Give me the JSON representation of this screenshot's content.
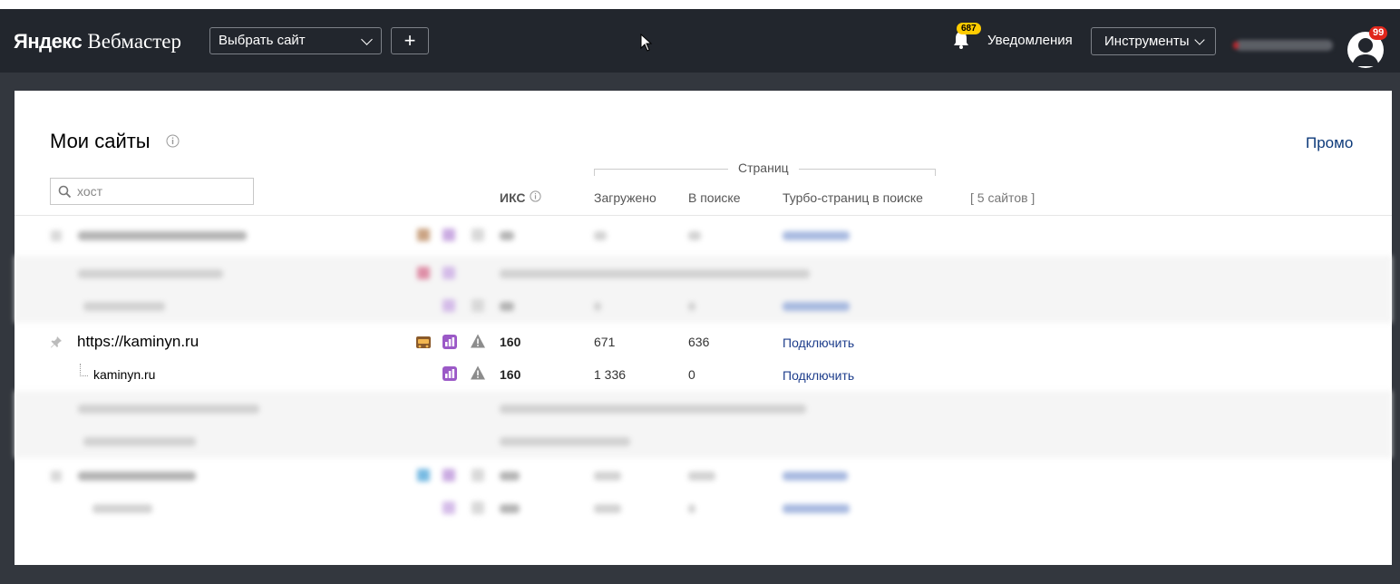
{
  "header": {
    "logo_brand": "Яндекс",
    "logo_product": "Вебмастер",
    "site_select_label": "Выбрать сайт",
    "add_site_label": "+",
    "notifications_count": "687",
    "notifications_label": "Уведомления",
    "tools_label": "Инструменты",
    "avatar_badge": "99"
  },
  "page": {
    "title": "Мои сайты",
    "promo_label": "Промо",
    "search_placeholder": "хост"
  },
  "table": {
    "col_iks": "ИКС",
    "pages_group_label": "Страниц",
    "col_loaded": "Загружено",
    "col_in_search": "В поиске",
    "col_turbo": "Турбо-страниц в поиске",
    "site_count": "[ 5 сайтов ]",
    "visible_rows": [
      {
        "host": "https://kaminyn.ru",
        "iks": "160",
        "loaded": "671",
        "in_search": "636",
        "turbo_action": "Подключить",
        "badge_icon": "site-quality-badge-icon"
      },
      {
        "host": "kaminyn.ru",
        "iks": "160",
        "loaded": "1 336",
        "in_search": "0",
        "turbo_action": "Подключить"
      }
    ]
  },
  "colors": {
    "header_bg": "#22262d",
    "workspace_bg": "#33373e",
    "link": "#1e3e8c",
    "promo": "#0d3a7a",
    "notif_badge": "#ffcc00",
    "avatar_badge": "#e0261b",
    "stats_icon": "#9b59c7"
  }
}
